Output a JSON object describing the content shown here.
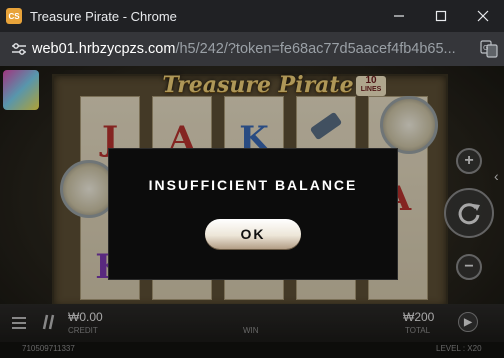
{
  "window": {
    "title": "Treasure Pirate - Chrome",
    "app_icon_text": "CS"
  },
  "address": {
    "host": "web01.hrbzycpzs.com",
    "path": "/h5/242/?token=fe68ac77d5aacef4fb4b65..."
  },
  "game": {
    "title": "Treasure Pirate",
    "lines_number": "10",
    "lines_label": "LINES",
    "reel_symbols": [
      [
        "J",
        "",
        "K"
      ],
      [
        "A",
        "",
        ""
      ],
      [
        "K",
        "",
        ""
      ],
      [
        "",
        "",
        ""
      ],
      [
        "",
        "A",
        ""
      ]
    ],
    "credit_value": "₩0.00",
    "credit_label": "CREDIT",
    "win_label": "WIN",
    "total_value": "₩200",
    "total_label": "TOTAL",
    "session_id": "710509711337",
    "level_label": "LEVEL : X20"
  },
  "modal": {
    "message": "INSUFFICIENT BALANCE",
    "ok_label": "OK"
  },
  "colors": {
    "titlebar_bg": "#202124",
    "addressbar_bg": "#35363a",
    "modal_bg": "#0c0c0c",
    "title_gold": "#f1d27a"
  }
}
